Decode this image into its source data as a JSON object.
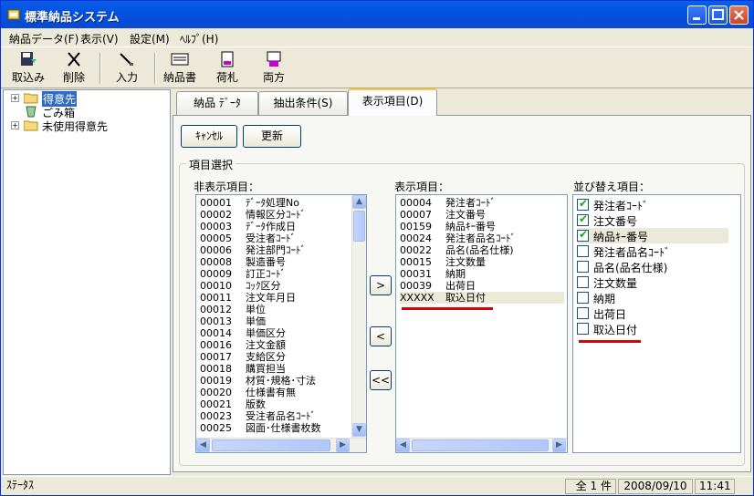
{
  "window": {
    "title": "標準納品システム"
  },
  "menu": [
    "納品データ(F)",
    "表示(V)",
    "設定(M)",
    "ﾍﾙﾌﾟ(H)"
  ],
  "toolbar": {
    "import": "取込み",
    "delete": "削除",
    "input": "入力",
    "delivery_slip": "納品書",
    "tag": "荷札",
    "both": "両方"
  },
  "tree": {
    "items": [
      "得意先",
      "ごみ箱",
      "未使用得意先"
    ]
  },
  "tabs": [
    "納品 ﾃﾞｰﾀ",
    "抽出条件(S)",
    "表示項目(D)"
  ],
  "buttons": {
    "cancel": "ｷｬﾝｾﾙ",
    "update": "更新"
  },
  "group_title": "項目選択",
  "hidden_list": {
    "label": "非表示項目：",
    "items": [
      {
        "code": "00001",
        "name": "ﾃﾞｰﾀ処理No"
      },
      {
        "code": "00002",
        "name": "情報区分ｺｰﾄﾞ"
      },
      {
        "code": "00003",
        "name": "ﾃﾞｰﾀ作成日"
      },
      {
        "code": "00005",
        "name": "受注者ｺｰﾄﾞ"
      },
      {
        "code": "00006",
        "name": "発注部門ｺｰﾄﾞ"
      },
      {
        "code": "00008",
        "name": "製造番号"
      },
      {
        "code": "00009",
        "name": "訂正ｺｰﾄﾞ"
      },
      {
        "code": "00010",
        "name": "ｺｯｸ区分"
      },
      {
        "code": "00011",
        "name": "注文年月日"
      },
      {
        "code": "00012",
        "name": "単位"
      },
      {
        "code": "00013",
        "name": "単価"
      },
      {
        "code": "00014",
        "name": "単価区分"
      },
      {
        "code": "00016",
        "name": "注文金額"
      },
      {
        "code": "00017",
        "name": "支給区分"
      },
      {
        "code": "00018",
        "name": "購買担当"
      },
      {
        "code": "00019",
        "name": "材質･規格･寸法"
      },
      {
        "code": "00020",
        "name": "仕様書有無"
      },
      {
        "code": "00021",
        "name": "版数"
      },
      {
        "code": "00023",
        "name": "受注者品名ｺｰﾄﾞ"
      },
      {
        "code": "00025",
        "name": "図面･仕様書枚数"
      }
    ]
  },
  "move_buttons": [
    ">",
    "<",
    "<<"
  ],
  "shown_list": {
    "label": "表示項目：",
    "items": [
      {
        "code": "00004",
        "name": "発注者ｺｰﾄﾞ"
      },
      {
        "code": "00007",
        "name": "注文番号"
      },
      {
        "code": "00159",
        "name": "納品ｷｰ番号"
      },
      {
        "code": "00024",
        "name": "発注者品名ｺｰﾄﾞ"
      },
      {
        "code": "00022",
        "name": "品名(品名仕様)"
      },
      {
        "code": "00015",
        "name": "注文数量"
      },
      {
        "code": "00031",
        "name": "納期"
      },
      {
        "code": "00039",
        "name": "出荷日"
      },
      {
        "code": "XXXXX",
        "name": "取込日付"
      }
    ]
  },
  "sort_list": {
    "label": "並び替え項目：",
    "items": [
      {
        "name": "発注者ｺｰﾄﾞ",
        "checked": true
      },
      {
        "name": "注文番号",
        "checked": true
      },
      {
        "name": "納品ｷｰ番号",
        "checked": true
      },
      {
        "name": "発注者品名ｺｰﾄﾞ",
        "checked": false
      },
      {
        "name": "品名(品名仕様)",
        "checked": false
      },
      {
        "name": "注文数量",
        "checked": false
      },
      {
        "name": "納期",
        "checked": false
      },
      {
        "name": "出荷日",
        "checked": false
      },
      {
        "name": "取込日付",
        "checked": false
      }
    ]
  },
  "status": {
    "label": "ｽﾃｰﾀｽ",
    "count": "全 1 件",
    "date": "2008/09/10",
    "time": "11:41"
  }
}
